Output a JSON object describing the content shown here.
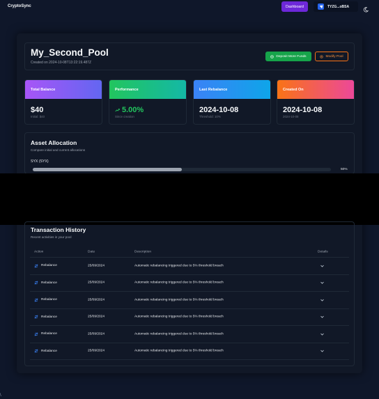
{
  "app": {
    "brand": "CryptoSync"
  },
  "nav": {
    "dashboard_label": "Dashboard",
    "wallet_address": "TYZG...oBSA",
    "icons": [
      "wallet-icon",
      "moon-icon"
    ]
  },
  "pool": {
    "title": "My_Second_Pool",
    "created": "Created on 2024-10-08T13:22:19.487Z",
    "deposit_label": "Deposit More Funds",
    "modify_label": "Modify Pool"
  },
  "stats": [
    {
      "label": "Total Balance",
      "value": "$40",
      "sub": "Initial: $40",
      "color_from": "#a855f7",
      "color_to": "#6366f1"
    },
    {
      "label": "Performance",
      "value": "5.00%",
      "sub": "Since creation",
      "color_from": "#22c55e",
      "color_to": "#14b8a6",
      "value_color": "#22c55e"
    },
    {
      "label": "Last Rebalance",
      "value": "2024-10-08",
      "sub": "Threshold: 10%",
      "color_from": "#3b82f6",
      "color_to": "#0ea5e9"
    },
    {
      "label": "Created On",
      "value": "2024-10-08",
      "sub": "2024-10-08",
      "color_from": "#f97316",
      "color_to": "#ec4899"
    }
  ],
  "allocation": {
    "title": "Asset Allocation",
    "subtitle": "Compare initial and current allocations",
    "asset": "SYX (SYX)",
    "percent_label": "50%",
    "fraction": 0.5
  },
  "transactions": {
    "title": "Transaction History",
    "subtitle": "Recent activities in your pool",
    "columns": [
      "Action",
      "Date",
      "Description",
      "Details"
    ],
    "rows": [
      {
        "action": "Rebalance",
        "date": "25/09/2024",
        "description": "Automatic rebalancing triggered due to 5% threshold breach"
      },
      {
        "action": "Rebalance",
        "date": "25/09/2024",
        "description": "Automatic rebalancing triggered due to 5% threshold breach"
      },
      {
        "action": "Rebalance",
        "date": "25/09/2024",
        "description": "Automatic rebalancing triggered due to 5% threshold breach"
      },
      {
        "action": "Rebalance",
        "date": "25/09/2024",
        "description": "Automatic rebalancing triggered due to 5% threshold breach"
      },
      {
        "action": "Rebalance",
        "date": "25/09/2024",
        "description": "Automatic rebalancing triggered due to 5% threshold breach"
      },
      {
        "action": "Rebalance",
        "date": "25/09/2024",
        "description": "Automatic rebalancing triggered due to 5% threshold breach"
      }
    ]
  },
  "corner_text": "\\"
}
